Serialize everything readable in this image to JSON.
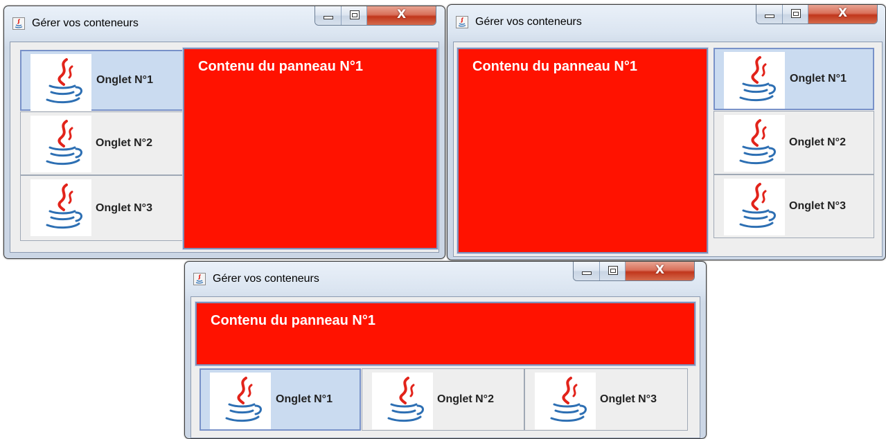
{
  "window_title": "Gérer vos conteneurs",
  "panel_text": "Contenu du panneau N°1",
  "tabs": [
    "Onglet N°1",
    "Onglet N°2",
    "Onglet N°3"
  ],
  "selected_tab": 0,
  "close_glyph": "X",
  "windows": [
    {
      "id": "tabs-left",
      "tab_placement": "left"
    },
    {
      "id": "tabs-right",
      "tab_placement": "right"
    },
    {
      "id": "tabs-bottom",
      "tab_placement": "bottom"
    }
  ],
  "colors": {
    "panel_background": "#ff1200",
    "panel_text": "#ffffff",
    "selected_tab": "#cadbf0",
    "tab_background": "#eeeeee",
    "close_button": "#c1361c"
  },
  "icons": {
    "app": "java-coffee-cup-icon",
    "tab": "java-coffee-cup-icon",
    "minimize": "minimize-icon",
    "maximize": "maximize-icon",
    "close": "close-icon"
  }
}
